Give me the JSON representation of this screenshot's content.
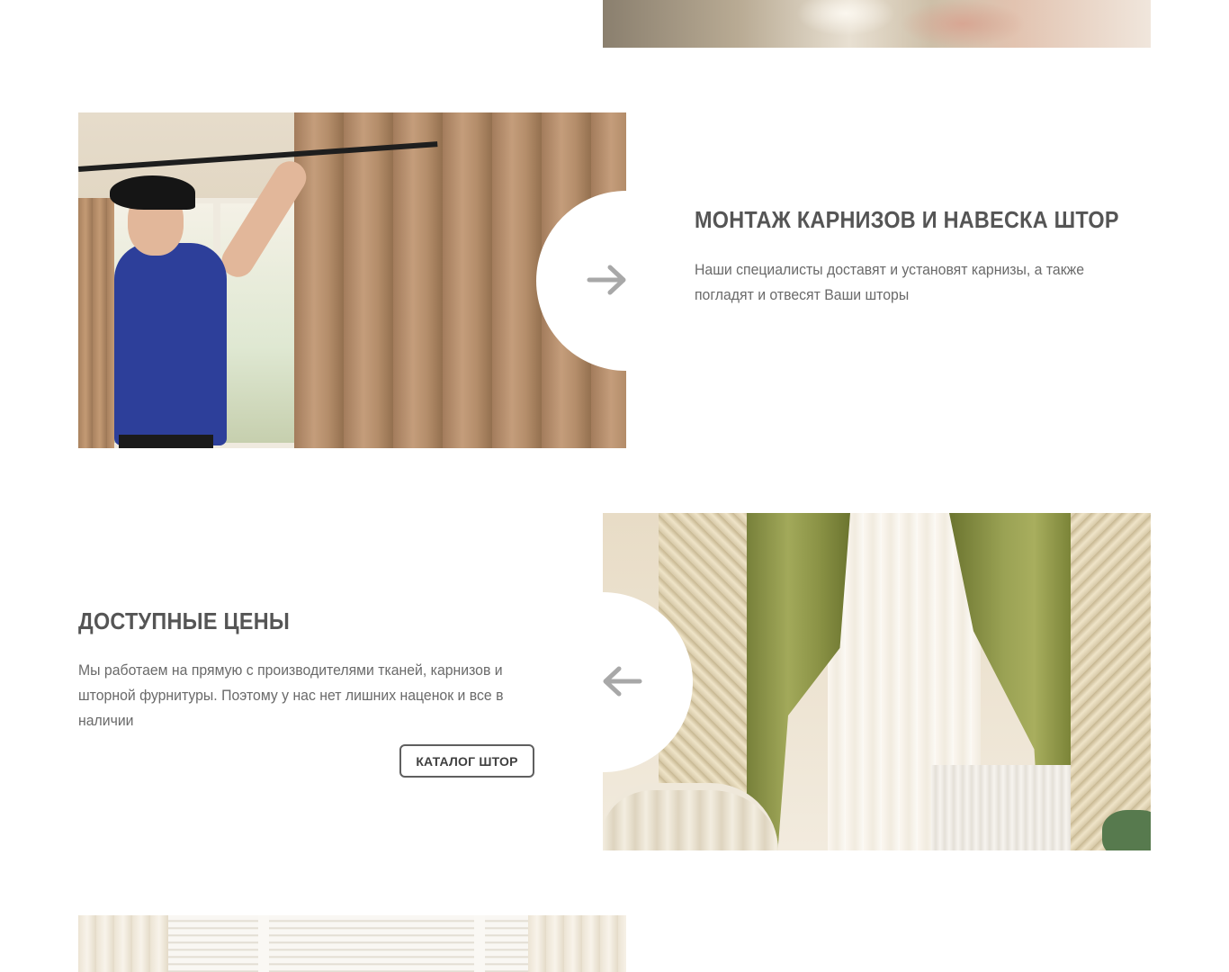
{
  "section_install": {
    "title": "МОНТАЖ КАРНИЗОВ И НАВЕСКА ШТОР",
    "text": "Наши специалисты доставят и установят карнизы, а также погладят и отвесят Ваши шторы",
    "arrow_icon": "arrow-right-icon"
  },
  "section_prices": {
    "title": "ДОСТУПНЫЕ ЦЕНЫ",
    "text": "Мы работаем на прямую с производителями тканей, карнизов и шторной фурнитуры. Поэтому у нас нет лишних наценок и все в наличии",
    "button_label": "КАТАЛОГ ШТОР",
    "arrow_icon": "arrow-left-icon"
  },
  "colors": {
    "heading": "#555555",
    "text": "#6a6a6a",
    "arrow": "#a8a8a8",
    "button_border": "#5f5f5f"
  }
}
